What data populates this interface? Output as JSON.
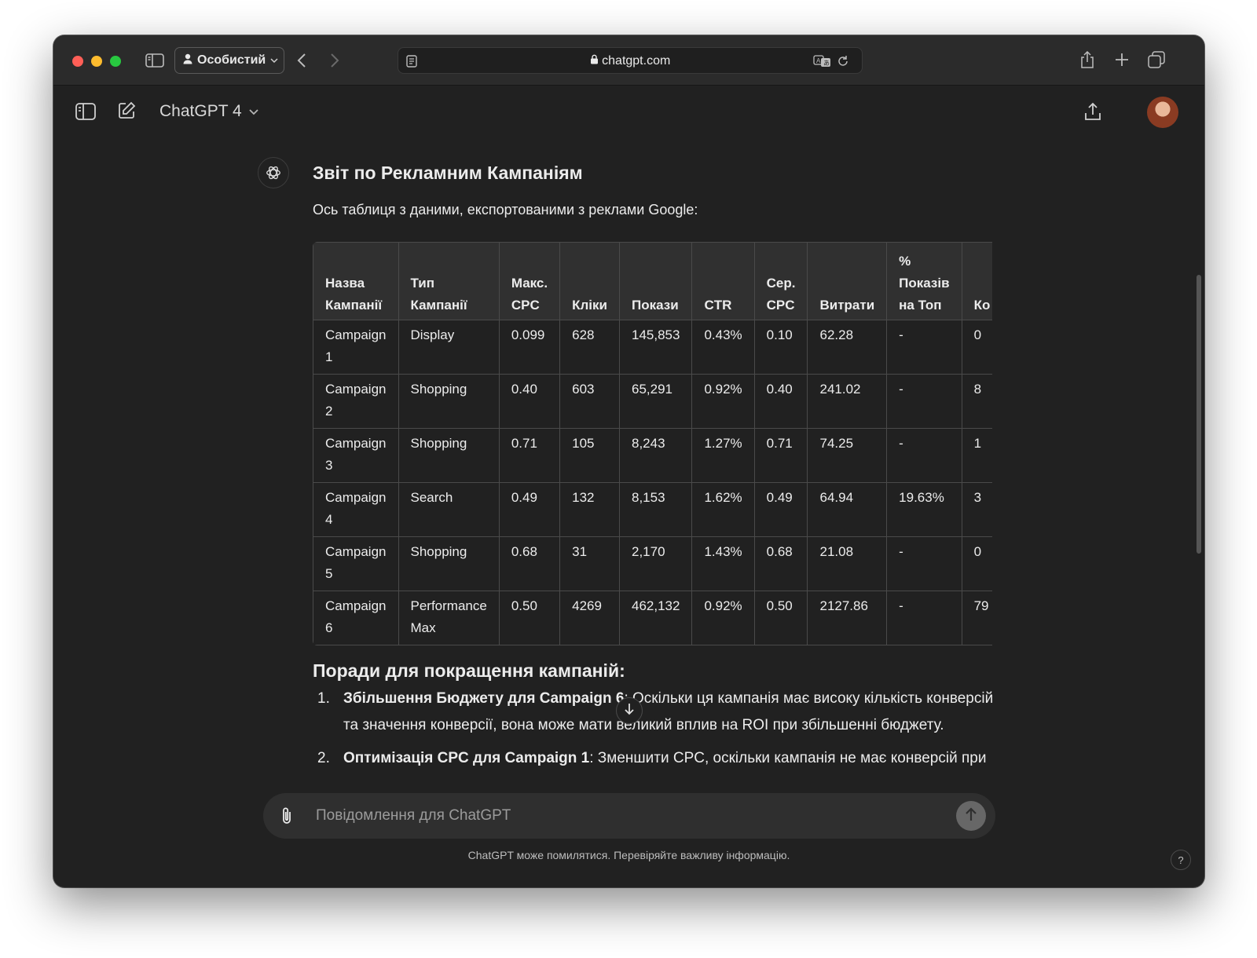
{
  "browser": {
    "profile_label": "Особистий",
    "url": "chatgpt.com"
  },
  "app": {
    "model_label": "ChatGPT 4"
  },
  "message": {
    "title": "Звіт по Рекламним Кампаніям",
    "intro": "Ось таблиця з даними, експортованими з реклами Google:",
    "table": {
      "headers": [
        "Назва Кампанії",
        "Тип Кампанії",
        "Макс. CPC",
        "Кліки",
        "Покази",
        "CTR",
        "Сер. CPC",
        "Витрати",
        "% Показів на Топ",
        "Ко"
      ],
      "rows": [
        [
          "Campaign 1",
          "Display",
          "0.099",
          "628",
          "145,853",
          "0.43%",
          "0.10",
          "62.28",
          "-",
          "0"
        ],
        [
          "Campaign 2",
          "Shopping",
          "0.40",
          "603",
          "65,291",
          "0.92%",
          "0.40",
          "241.02",
          "-",
          "8"
        ],
        [
          "Campaign 3",
          "Shopping",
          "0.71",
          "105",
          "8,243",
          "1.27%",
          "0.71",
          "74.25",
          "-",
          "1"
        ],
        [
          "Campaign 4",
          "Search",
          "0.49",
          "132",
          "8,153",
          "1.62%",
          "0.49",
          "64.94",
          "19.63%",
          "3"
        ],
        [
          "Campaign 5",
          "Shopping",
          "0.68",
          "31",
          "2,170",
          "1.43%",
          "0.68",
          "21.08",
          "-",
          "0"
        ],
        [
          "Campaign 6",
          "Performance Max",
          "0.50",
          "4269",
          "462,132",
          "0.92%",
          "0.50",
          "2127.86",
          "-",
          "79"
        ]
      ]
    },
    "tips_title": "Поради для покращення кампаній:",
    "tips": [
      {
        "num": "1.",
        "bold": "Збільшення Бюджету для Campaign 6",
        "text": ": Оскільки ця кампанія має високу кількість конверсій та значення конверсії, вона може мати великий вплив на ROI при збільшенні бюджету."
      },
      {
        "num": "2.",
        "bold": "Оптимізація CPC для Campaign 1",
        "text": ": Зменшити CPC, оскільки кампанія не має конверсій при"
      }
    ]
  },
  "composer": {
    "placeholder": "Повідомлення для ChatGPT"
  },
  "footer": {
    "disclaimer": "ChatGPT може помилятися. Перевіряйте важливу інформацію.",
    "help": "?"
  }
}
